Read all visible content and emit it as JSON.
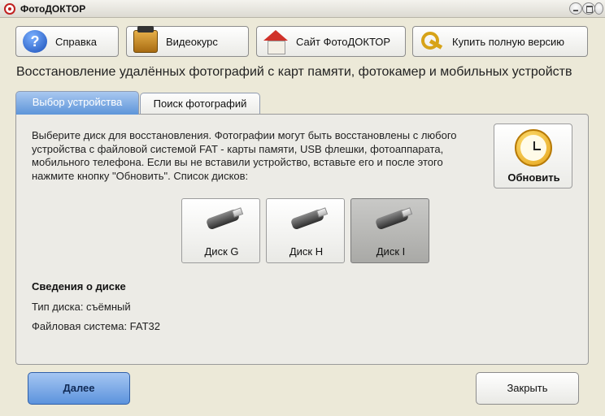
{
  "window": {
    "title": "ФотоДОКТОР"
  },
  "toolbar": {
    "help": "Справка",
    "video": "Видеокурс",
    "site": "Сайт ФотоДОКТОР",
    "buy": "Купить полную версию"
  },
  "heading": "Восстановление удалённых фотографий с карт памяти, фотокамер и мобильных устройств",
  "tabs": [
    {
      "label": "Выбор устройства",
      "active": true
    },
    {
      "label": "Поиск фотографий",
      "active": false
    }
  ],
  "panel": {
    "description": "Выберите диск для восстановления. Фотографии могут быть восстановлены с любого устройства с файловой системой FAT - карты памяти, USB флешки, фотоаппарата, мобильного телефона. Если вы не вставили устройство, вставьте его и после этого нажмите кнопку \"Обновить\". Список дисков:",
    "refresh_label": "Обновить",
    "disks": [
      {
        "label": "Диск G",
        "selected": false
      },
      {
        "label": "Диск H",
        "selected": false
      },
      {
        "label": "Диск I",
        "selected": true
      }
    ],
    "info": {
      "title": "Сведения о диске",
      "type_line": "Тип диска: съёмный",
      "fs_line": "Файловая система: FAT32"
    }
  },
  "footer": {
    "next_label": "Далее",
    "close_label": "Закрыть"
  },
  "icons": [
    "help-icon",
    "video-course-icon",
    "home-icon",
    "key-icon",
    "clock-icon",
    "usb-drive-icon"
  ],
  "colors": {
    "accent_blue": "#5d95d9",
    "selected_disk": "#a9a9a6",
    "background": "#ece9d8"
  }
}
